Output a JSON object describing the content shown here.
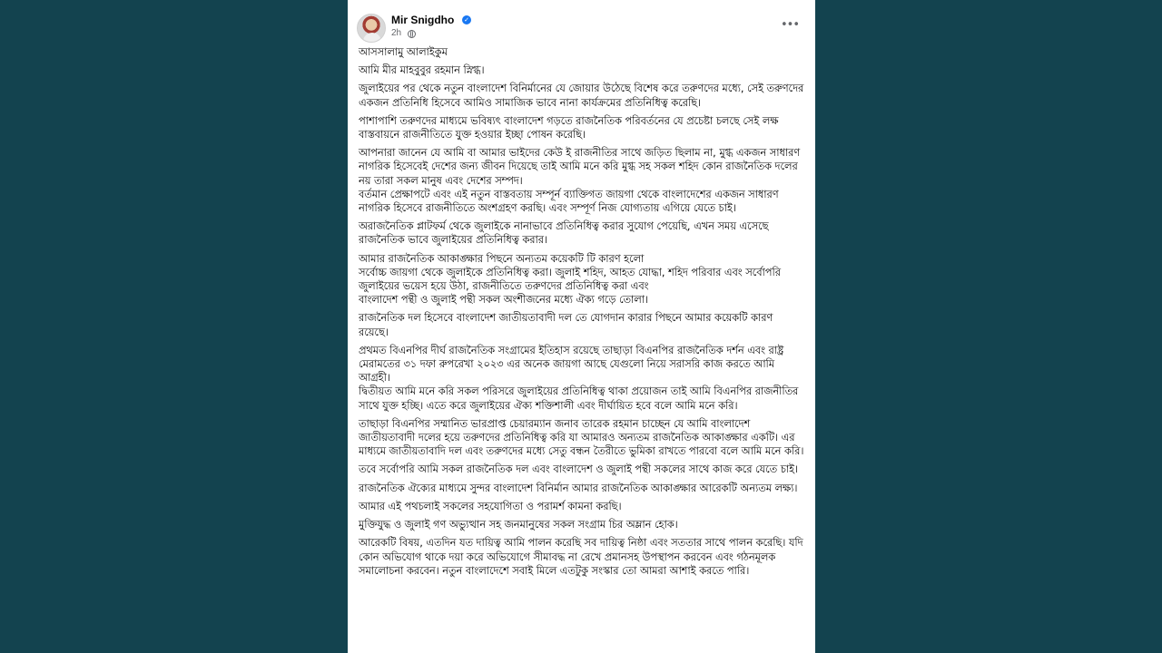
{
  "author": {
    "name": "Mir Snigdho",
    "time": "2h"
  },
  "icons": {
    "verified": "verified-badge-icon",
    "privacy": "globe-icon",
    "menu": "more-options-icon"
  },
  "colors": {
    "background": "#13434f",
    "card": "#ffffff",
    "verified": "#1877f2",
    "secondary_text": "#65676b"
  },
  "post": {
    "paragraphs": [
      "আসসালামু আলাইকুম",
      "আমি মীর মাহবুবুর রহমান স্নিগ্ধ।",
      "জুলাইয়ের পর থেকে নতুন বাংলাদেশ বিনির্মানের যে জোয়ার উঠেছে বিশেষ করে তরুণদের মধ্যে, সেই তরুণদের একজন প্রতিনিধি হিসেবে আমিও সামাজিক ভাবে নানা কার্যক্রমের প্রতিনিধিত্ব করেছি।",
      "পাশাপাশি তরুণদের মাধ্যমে ভবিষ্যৎ বাংলাদেশ গড়তে রাজনৈতিক পরিবর্তনের যে প্রচেষ্টা চলছে সেই লক্ষ বাস্তবায়নে রাজনীতিতে যুক্ত হওয়ার ইচ্ছা পোষন করেছি।",
      "আপনারা জানেন যে আমি বা আমার ভাইদের কেউ ই রাজনীতির সাথে জড়িত ছিলাম না, মুগ্ধ একজন সাধারণ নাগরিক হিসেবেই দেশের জন্য জীবন দিয়েছে তাই আমি মনে করি মুগ্ধ সহ সকল শহিদ কোন রাজনৈতিক দলের নয় তারা সকল মানুষ এবং দেশের সম্পদ।\nবর্তমান প্রেক্ষাপটে এবং এই নতুন বাস্তবতায় সম্পূর্ন ব্যাক্তিগত জায়গা থেকে বাংলাদেশের একজন সাধারণ নাগরিক হিসেবে রাজনীতিতে অংশগ্রহণ করছি। এবং সম্পূর্ণ নিজ যোগ্যতায় এগিয়ে যেতে চাই।",
      "অরাজনৈতিক প্লাটফর্ম থেকে জুলাইকে নানাভাবে প্রতিনিধিত্ব করার সুযোগ পেয়েছি, এখন সময় এসেছে রাজনৈতিক ভাবে জুলাইয়ের প্রতিনিধিত্ব করার।",
      "আমার রাজনৈতিক আকাঙ্ক্ষার পিছনে অন্যতম কয়েকটি টি কারণ হলো\nসর্বোচ্চ জায়গা থেকে জুলাইকে প্রতিনিধিত্ব করা। জুলাই শহিদ, আহত যোদ্ধা, শহিদ পরিবার এবং সর্বোপরি জুলাইয়ের ভয়েস হয়ে উঠা, রাজনীতিতে তরুণদের প্রতিনিধিত্ব করা এবং\nবাংলাদেশ পন্থী ও জুলাই পন্থী সকল অংশীজনের মধ্যে ঐক্য গড়ে তোলা।",
      "রাজনৈতিক দল হিসেবে বাংলাদেশ জাতীয়তাবাদী দল তে যোগদান কারার পিছনে আমার কয়েকটি কারণ রয়েছে।",
      "প্রথমত বিএনপির দীর্ঘ রাজনৈতিক সংগ্রামের ইতিহাস রয়েছে তাছাড়া বিএনপির রাজনৈতিক দর্শন এবং রাষ্ট্র মেরামতের ৩১ দফা রুপরেখা ২০২৩ এর অনেক জায়গা আছে যেগুলো নিয়ে সরাসরি কাজ করতে আমি আগ্রহী।\nদ্বিতীয়ত আমি মনে করি সকল পরিসরে জুলাইয়ের প্রতিনিধিত্ব থাকা প্রয়োজন তাই আমি বিএনপির রাজনীতির সাথে যুক্ত হচ্ছি। এতে করে জুলাইয়ের ঐক্য শক্তিশালী এবং দীর্ঘায়িত হবে বলে আমি মনে করি।",
      "তাছাড়া বিএনপির সম্মানিত ভারপ্রাপ্ত চেয়ারম্যান জনাব তারেক রহমান চাচ্ছেন যে আমি বাংলাদেশ জাতীয়তাবাদী দলের হয়ে তরুণদের প্রতিনিধিত্ব করি যা আমারও অন্যতম রাজনৈতিক আকাঙ্ক্ষার একটি। এর মাধ্যমে জাতীয়তাবাদি দল এবং তরুণদের মধ্যে সেতু বন্ধন তৈরীতে ভুমিকা রাখতে পারবো বলে আমি মনে করি।",
      "তবে সর্বোপরি আমি সকল রাজনৈতিক দল এবং বাংলাদেশ ও জুলাই পন্থী সকলের সাথে কাজ করে যেতে চাই।",
      "রাজনৈতিক ঐক্যের মাধ্যমে সুন্দর বাংলাদেশ বিনির্মান আমার রাজনৈতিক আকাঙ্ক্ষার আরেকটি অন্যতম লক্ষ্য।",
      "আমার এই পথচলাই সকলের সহযোগিতা ও পরামর্শ কামনা করছি।",
      "মুক্তিযুদ্ধ ও জুলাই গণ অভ্যুত্থান সহ জনমানুষের সকল সংগ্রাম চির অম্লান হোক।",
      "আরেকটি বিষয়, এতদিন যত দায়িত্ব আমি পালন করেছি সব দায়িত্ব নিষ্ঠা এবং সততার সাথে পালন করেছি। যদি কোন অভিযোগ থাকে দয়া করে অভিযোগে সীমাবদ্ধ না রেখে প্রমানসহ উপস্থাপন করবেন এবং গঠনমূলক সমালোচনা করবেন। নতুন বাংলাদেশে সবাই মিলে এতটুকু সংস্কার তো আমরা আশাই করতে পারি।"
    ]
  }
}
